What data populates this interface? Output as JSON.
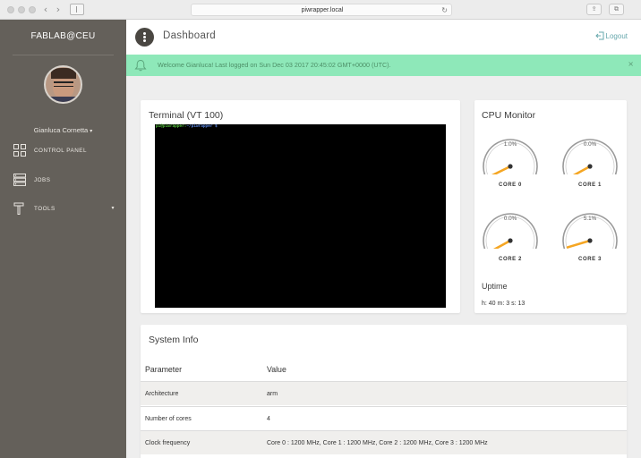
{
  "browser": {
    "url": "piwrapper.local",
    "back_icon": "chevron-left-icon",
    "forward_icon": "chevron-right-icon",
    "reload_icon": "reload-icon"
  },
  "sidebar": {
    "brand": "FABLAB@CEU",
    "user_name": "Gianluca Cornetta",
    "items": [
      {
        "label": "CONTROL PANEL",
        "icon": "grid-icon"
      },
      {
        "label": "JOBS",
        "icon": "server-icon"
      },
      {
        "label": "TOOLS",
        "icon": "hammer-icon"
      }
    ]
  },
  "header": {
    "title": "Dashboard",
    "logout_label": "Logout"
  },
  "alert": {
    "message": "Welcome Gianluca! Last logged on Sun Dec 03 2017 20:45:02 GMT+0000 (UTC).",
    "close": "×"
  },
  "terminal": {
    "title": "Terminal (VT 100)",
    "prompt_user": "pi@piwrapper",
    "prompt_sep": ":",
    "prompt_path": "~/piwrapper $"
  },
  "cpu": {
    "title": "CPU Monitor",
    "cores": [
      {
        "label": "CORE 0",
        "value_text": "1.0%",
        "value": 1.0
      },
      {
        "label": "CORE 1",
        "value_text": "0.0%",
        "value": 0.0
      },
      {
        "label": "CORE 2",
        "value_text": "0.0%",
        "value": 0.0
      },
      {
        "label": "CORE 3",
        "value_text": "5.1%",
        "value": 5.1
      }
    ],
    "uptime_title": "Uptime",
    "uptime_value": "h: 40 m: 3 s: 13"
  },
  "system_info": {
    "title": "System Info",
    "header": {
      "param": "Parameter",
      "value": "Value"
    },
    "rows": [
      {
        "param": "Architecture",
        "value": "arm"
      },
      {
        "param": "Number of cores",
        "value": "4"
      },
      {
        "param": "Clock frequency",
        "value": "Core 0 : 1200 MHz, Core 1 : 1200 MHz, Core 2 : 1200 MHz, Core 3 : 1200 MHz"
      }
    ]
  },
  "colors": {
    "sidebar": "#64605a",
    "alert_bg": "#8ee8b9",
    "accent": "#67a8ad",
    "gauge_needle": "#f5a623"
  }
}
